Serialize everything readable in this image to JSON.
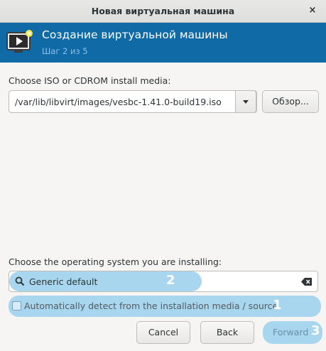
{
  "window": {
    "title": "Новая виртуальная машина",
    "close_glyph": "×"
  },
  "header": {
    "title": "Создание виртуальной машины",
    "step": "Шаг 2 из 5",
    "icon": "new-vm-icon"
  },
  "media": {
    "label": "Choose ISO or CDROM install media:",
    "value": "/var/lib/libvirt/images/vesbc-1.41.0-build19.iso",
    "browse_label": "Обзор..."
  },
  "os": {
    "label": "Choose the operating system you are installing:",
    "search_value": "Generic default",
    "auto_detect_label": "Automatically detect from the installation media / source",
    "auto_detect_checked": false
  },
  "buttons": {
    "cancel": "Cancel",
    "back": "Back",
    "forward": "Forward"
  },
  "annotations": {
    "badge_1": "1",
    "badge_2": "2",
    "badge_3": "3"
  },
  "colors": {
    "header_bg": "#0f6aa6",
    "highlight": "#a8d6ee"
  }
}
